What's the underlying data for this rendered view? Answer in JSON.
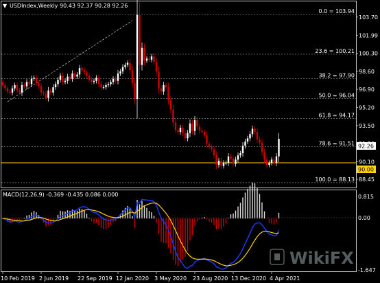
{
  "symbol_header": "USDIndex,Weekly  90.43 92.37 90.28 92.26",
  "macd_header": "MACD(12,26,9) -0.369 -0.435 0.086 0.000",
  "price_axis": {
    "labels": [
      "103.70",
      "101.99",
      "100.30",
      "98.60",
      "96.90",
      "95.20",
      "93.50",
      "91.80",
      "90.10",
      "88.45"
    ],
    "current_price": "92.26",
    "level_price": "90.00"
  },
  "macd_axis": {
    "top": "0.815",
    "zero": "0.00",
    "bottom": "-1.647"
  },
  "fib_levels": [
    {
      "label": "0.0 = 103.94",
      "value": 103.94
    },
    {
      "label": "23.6 = 100.21",
      "value": 100.21
    },
    {
      "label": "38.2 = 97.90",
      "value": 97.9
    },
    {
      "label": "50.0 = 96.04",
      "value": 96.04
    },
    {
      "label": "61.8 = 94.17",
      "value": 94.17
    },
    {
      "label": "78.6 = 91.51",
      "value": 91.51
    },
    {
      "label": "100.0 = 88.13",
      "value": 88.13
    }
  ],
  "x_axis_labels": [
    "10 Feb 2019",
    "2 Jun 2019",
    "22 Sep 2019",
    "12 Jan 2020",
    "3 May 2020",
    "23 Aug 2020",
    "13 Dec 2020",
    "4 Apr 2021"
  ],
  "colors": {
    "bull": "#ffffff",
    "bear": "#d40000",
    "macd_line": "#1e3cff",
    "signal_line": "#ffd400",
    "level": "#ffd400"
  },
  "watermark": "WikiFX",
  "chart_data": {
    "type": "line",
    "title": "USDIndex,Weekly",
    "ylim": [
      88.0,
      104.4
    ],
    "closes": [
      97.3,
      97.0,
      96.7,
      96.6,
      97.0,
      97.3,
      96.8,
      96.6,
      97.3,
      97.2,
      97.6,
      97.4,
      97.9,
      98.0,
      97.5,
      97.2,
      96.6,
      96.5,
      96.1,
      96.8,
      96.6,
      97.1,
      97.4,
      97.8,
      98.2,
      97.6,
      97.7,
      98.1,
      97.9,
      98.4,
      98.1,
      98.3,
      98.9,
      98.7,
      98.5,
      98.2,
      97.8,
      97.6,
      97.7,
      98.0,
      97.4,
      97.1,
      97.1,
      97.3,
      97.4,
      97.6,
      97.9,
      97.7,
      98.4,
      98.6,
      99.0,
      99.2,
      99.4,
      98.7,
      97.5,
      96.0,
      103.9,
      99.2,
      100.8,
      99.6,
      99.8,
      99.7,
      100.0,
      99.5,
      98.6,
      97.0,
      96.7,
      97.3,
      97.1,
      95.9,
      95.0,
      93.8,
      93.1,
      92.9,
      93.3,
      92.8,
      92.3,
      92.8,
      93.7,
      93.0,
      94.0,
      93.4,
      93.0,
      92.9,
      92.6,
      91.8,
      91.5,
      91.3,
      90.7,
      89.8,
      90.2,
      89.7,
      90.0,
      90.0,
      90.6,
      90.4,
      89.9,
      90.3,
      90.7,
      90.9,
      91.6,
      92.0,
      92.3,
      92.7,
      93.2,
      92.9,
      92.2,
      91.9,
      91.0,
      90.3,
      89.8,
      90.0,
      90.3,
      90.0,
      90.6,
      92.26
    ],
    "fib_levels": [
      103.94,
      100.21,
      97.9,
      96.04,
      94.17,
      91.51,
      88.13
    ],
    "horizontal_level": 90.0
  }
}
